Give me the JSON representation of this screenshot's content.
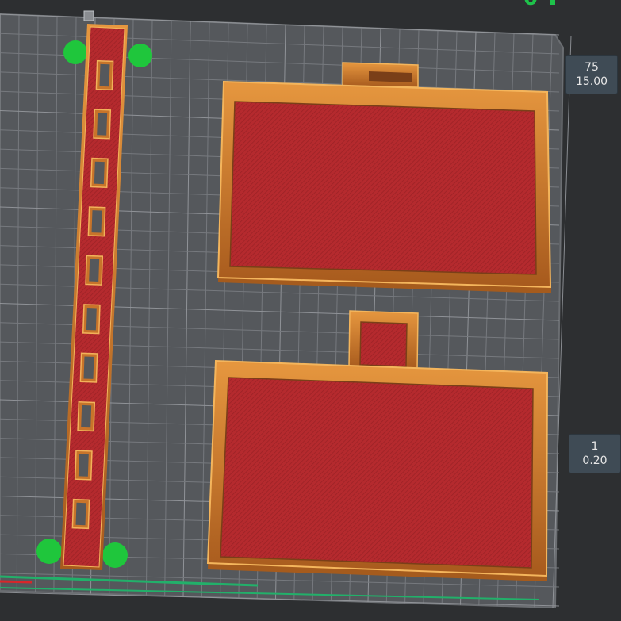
{
  "layer_slider": {
    "top": {
      "layer": "75",
      "height": "15.00"
    },
    "bottom": {
      "layer": "1",
      "height": "0.20"
    }
  },
  "colors": {
    "background": "#2d2f31",
    "bed": "#55585c",
    "grid": "#7a7d82",
    "print_fill": "#b52a2e",
    "print_wall": "#c8742a",
    "wall_highlight": "#f4b55c",
    "support_brim": "#1fc63c",
    "axis_x": "#d8262a",
    "axis_y": "#22b06a"
  },
  "icons": {
    "view_gizmo": "view-gizmo-icon"
  }
}
